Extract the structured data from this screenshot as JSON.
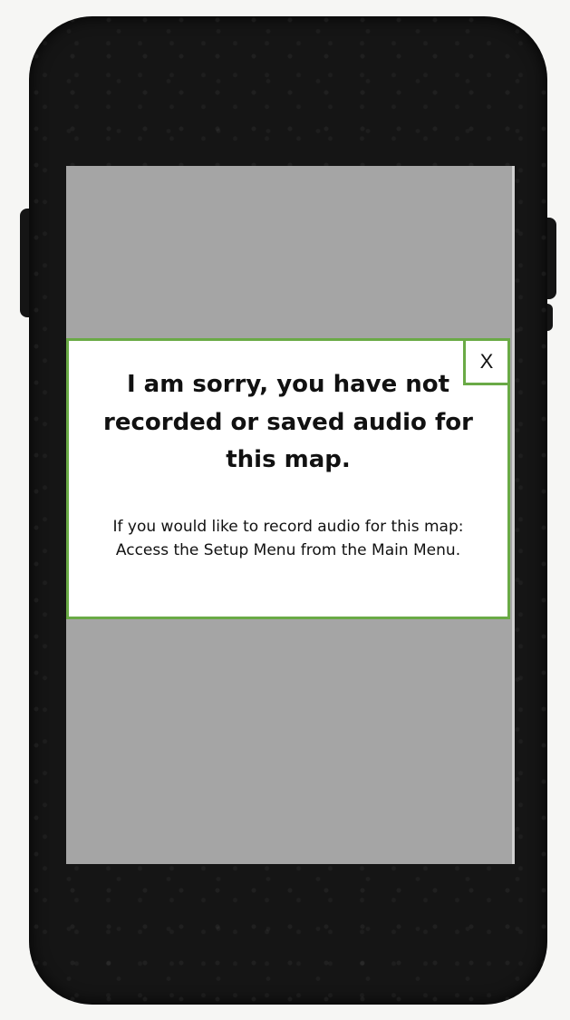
{
  "dialog": {
    "title": "I am sorry, you have not recorded or saved audio for this map.",
    "message": "If you would like to record audio for this map: Access the Setup Menu from the Main Menu.",
    "close_label": "X"
  },
  "colors": {
    "phone_body": "#151515",
    "screen": "#a5a5a5",
    "dialog_border": "#6aaa46",
    "dialog_background": "#ffffff"
  }
}
